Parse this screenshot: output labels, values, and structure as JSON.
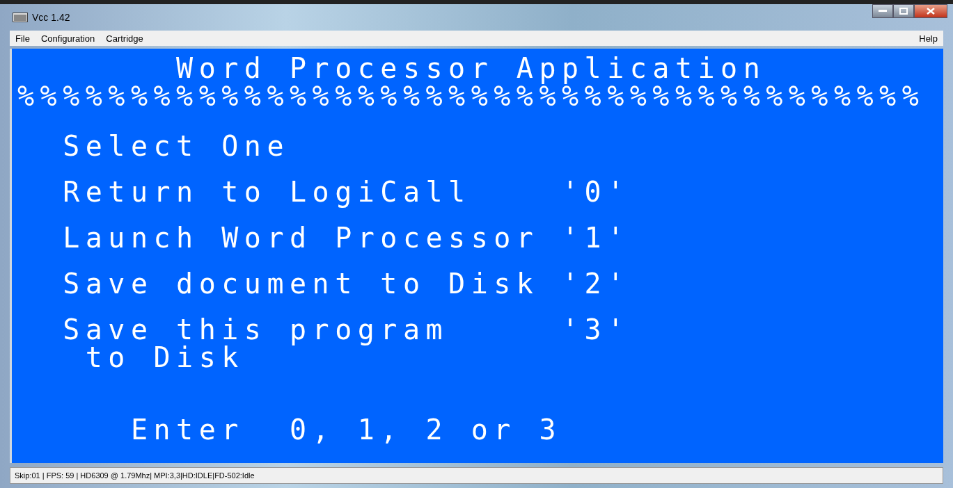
{
  "window": {
    "title": "Vcc 1.42"
  },
  "menu": [
    "File",
    "Configuration",
    "Cartridge"
  ],
  "help_menu": "Help",
  "screen": {
    "lines": [
      "       Word Processor Application",
      "%%%%%%%%%%%%%%%%%%%%%%%%%%%%%%%%%%%%%%%%",
      "  Select One",
      "  Return to LogiCall    '0'",
      "  Launch Word Processor '1'",
      "  Save document to Disk '2'",
      "  Save this program     '3'",
      "   to Disk",
      "     Enter  0, 1, 2 or 3"
    ]
  },
  "status_bar": "Skip:01 | FPS: 59 | HD6309 @ 1.79Mhz| MPI:3,3|HD:IDLE|FD-502:Idle"
}
